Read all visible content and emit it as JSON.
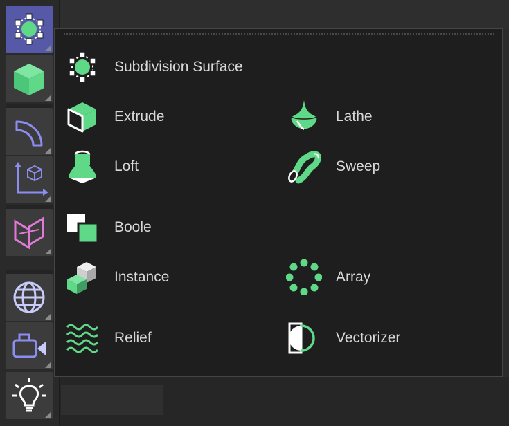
{
  "toolbar": {
    "buttons": [
      {
        "name": "subdivision-tool-button",
        "icon": "subdivision-icon",
        "active": true
      },
      {
        "name": "cube-tool-button",
        "icon": "cube-icon",
        "active": false
      },
      {
        "name": "spline-tool-button",
        "icon": "spline-icon",
        "active": false
      },
      {
        "name": "coordinate-tool-button",
        "icon": "coordinate-system-icon",
        "active": false
      },
      {
        "name": "deformer-tool-button",
        "icon": "deformer-icon",
        "active": false
      },
      {
        "name": "environment-tool-button",
        "icon": "globe-icon",
        "active": false
      },
      {
        "name": "camera-tool-button",
        "icon": "camera-icon",
        "active": false
      },
      {
        "name": "light-tool-button",
        "icon": "light-bulb-icon",
        "active": false
      }
    ]
  },
  "popup": {
    "items": [
      {
        "label": "Subdivision Surface",
        "icon": "subdivision-surface-icon"
      },
      {
        "label": "Extrude",
        "icon": "extrude-icon"
      },
      {
        "label": "Lathe",
        "icon": "lathe-icon"
      },
      {
        "label": "Loft",
        "icon": "loft-icon"
      },
      {
        "label": "Sweep",
        "icon": "sweep-icon"
      },
      {
        "label": "Boole",
        "icon": "boole-icon"
      },
      {
        "label": "Instance",
        "icon": "instance-icon"
      },
      {
        "label": "Array",
        "icon": "array-icon"
      },
      {
        "label": "Relief",
        "icon": "relief-icon"
      },
      {
        "label": "Vectorizer",
        "icon": "vectorizer-icon"
      }
    ]
  },
  "colors": {
    "accent_green": "#5fd888",
    "active_button": "#5658a8",
    "toolbar_purple": "#8c8df0",
    "deformer_pink": "#e07ad8",
    "text": "#d8d8d8"
  }
}
